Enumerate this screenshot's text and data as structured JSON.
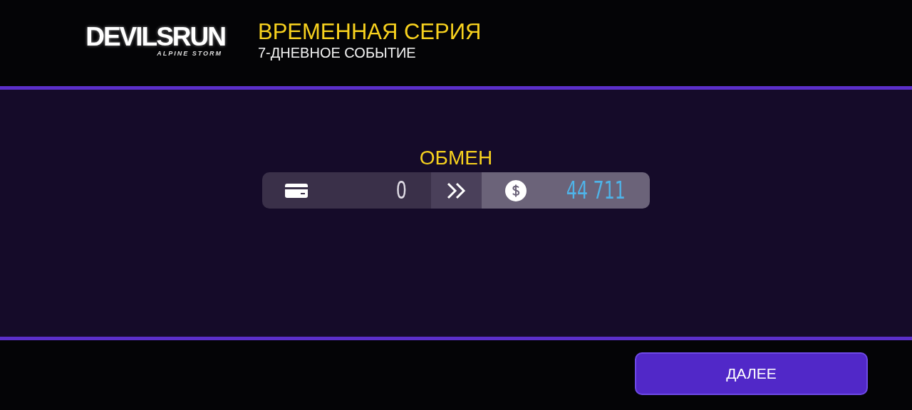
{
  "header": {
    "logo": {
      "main": "DEVILSRUN",
      "sub": "ALPINE STORM"
    },
    "title": "ВРЕМЕННАЯ СЕРИЯ",
    "subtitle": "7-ДНЕВНОЕ СОБЫТИЕ"
  },
  "exchange": {
    "title": "ОБМЕН",
    "from_amount": "0",
    "to_amount": "44 711"
  },
  "footer": {
    "next_button": "ДАЛЕЕ"
  }
}
